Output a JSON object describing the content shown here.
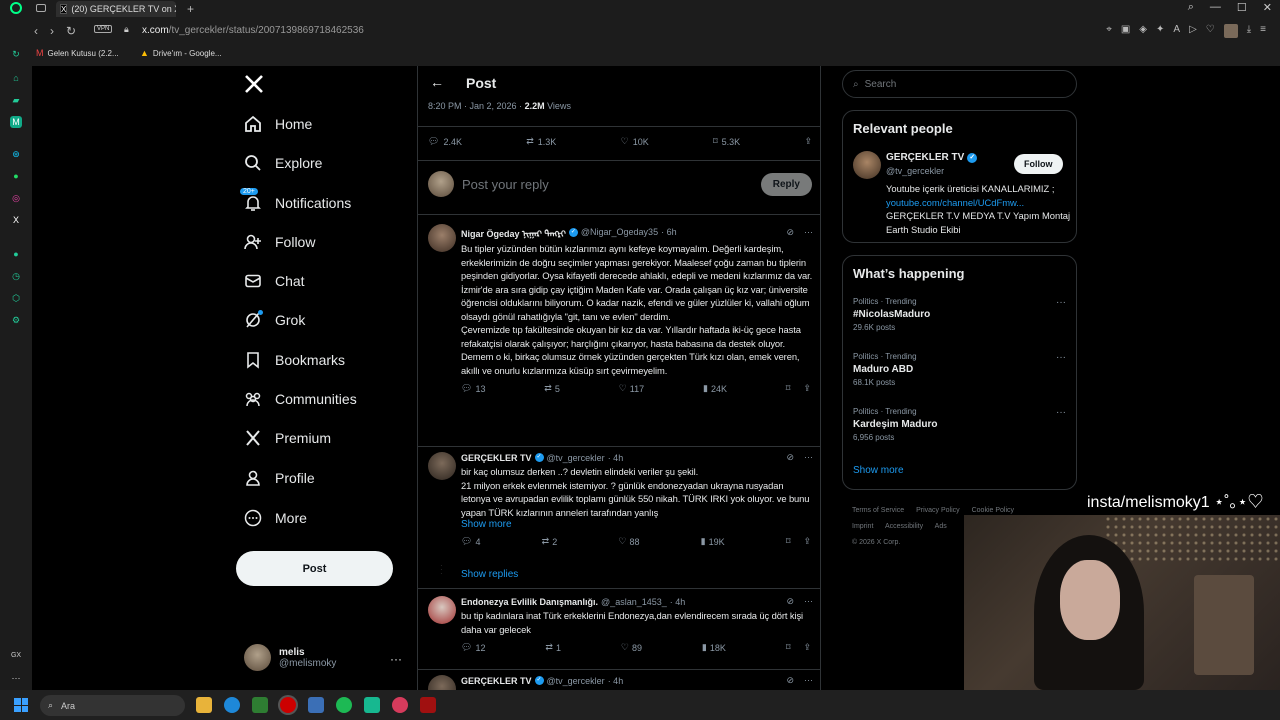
{
  "browser": {
    "tab_title": "(20) GERÇEKLER TV on X",
    "url_host": "x.com",
    "url_path": "/tv_gercekler/status/2007139869718462536",
    "vpn_label": "VPN",
    "bookmarks": [
      "Gelen Kutusu (2.2...",
      "Drive'ım - Google..."
    ]
  },
  "nav": {
    "logo": "X",
    "items": [
      {
        "label": "Home",
        "icon": "home-icon"
      },
      {
        "label": "Explore",
        "icon": "search-icon"
      },
      {
        "label": "Notifications",
        "icon": "bell-icon",
        "badge": "20+"
      },
      {
        "label": "Follow",
        "icon": "person-plus-icon"
      },
      {
        "label": "Chat",
        "icon": "mail-icon"
      },
      {
        "label": "Grok",
        "icon": "grok-icon"
      },
      {
        "label": "Bookmarks",
        "icon": "bookmark-icon"
      },
      {
        "label": "Communities",
        "icon": "people-icon"
      },
      {
        "label": "Premium",
        "icon": "x-icon"
      },
      {
        "label": "Profile",
        "icon": "person-icon"
      },
      {
        "label": "More",
        "icon": "more-circle-icon"
      }
    ],
    "post_button": "Post",
    "user_name": "melis",
    "user_handle": "@melismoky"
  },
  "post": {
    "header_title": "Post",
    "time": "8:20 PM · Jan 2, 2026 · ",
    "views": "2.2M",
    "views_label": "Views",
    "stats": {
      "replies": "2.4K",
      "reposts": "1.3K",
      "likes": "10K",
      "bookmarks": "5.3K"
    },
    "reply_placeholder": "Post your reply",
    "reply_button": "Reply"
  },
  "replies": [
    {
      "name": "Nigar Ögeday ᠨᠢᠭᠠᠷ ᠲᠠᠩᠷᠢ",
      "handle": "@Nigar_Ogeday35",
      "time": "· 6h",
      "text": "Bu tipler yüzünden bütün kızlarımızı aynı kefeye koymayalım. Değerli kardeşim, erkeklerimizin de doğru seçimler yapması gerekiyor. Maalesef çoğu zaman bu tiplerin peşinden gidiyorlar. Oysa kifayetli derecede ahlaklı, edepli ve medeni kızlarımız da var.\nİzmir'de ara sıra gidip çay içtiğim Maden Kafe var. Orada çalışan üç kız var; üniversite öğrencisi olduklarını biliyorum. O kadar nazik, efendi ve güler yüzlüler ki, vallahi oğlum olsaydı gönül rahatlığıyla \"git, tanı ve evlen\" derdim.\nÇevremizde tıp fakültesinde okuyan bir kız da var. Yıllardır haftada iki-üç gece hasta refakatçisi olarak çalışıyor; harçlığını çıkarıyor, hasta babasına da destek oluyor.\nDemem o ki, birkaç olumsuz örnek yüzünden gerçekten Türk kızı olan, emek veren, akıllı ve onurlu kızlarımıza küsüp sırt çevirmeyelim.",
      "replies": "13",
      "reposts": "5",
      "likes": "117",
      "views": "24K"
    },
    {
      "name": "GERÇEKLER TV",
      "handle": "@tv_gercekler",
      "time": "· 4h",
      "text": "bir kaç olumsuz derken ..? devletin elindeki veriler şu şekil.\n21 milyon erkek evlenmek istemiyor. ? günlük endonezyadan ukrayna rusyadan letonya ve avrupadan evlilik toplamı günlük 550 nikah. TÜRK IRKI yok oluyor. ve bunu yapan TÜRK kızlarının anneleri tarafından yanlış",
      "show_more": "Show more",
      "replies": "4",
      "reposts": "2",
      "likes": "88",
      "views": "19K"
    },
    {
      "name": "Endonezya Evlilik Danışmanlığı.",
      "handle": "@_aslan_1453_",
      "time": "· 4h",
      "text": "bu tip kadınlara inat Türk erkeklerini Endonezya,dan evlendirecem sırada üç dört kişi daha var gelecek",
      "replies": "12",
      "reposts": "1",
      "likes": "89",
      "views": "18K"
    },
    {
      "name": "GERÇEKLER TV",
      "handle": "@tv_gercekler",
      "time": "· 4h"
    }
  ],
  "show_replies": "Show replies",
  "right": {
    "search_placeholder": "Search",
    "relevant_title": "Relevant people",
    "person": {
      "name": "GERÇEKLER TV",
      "handle": "@tv_gercekler",
      "follow": "Follow",
      "bio1": "Youtube içerik üreticisi KANALLARIMIZ ; ",
      "bio_link": "youtube.com/channel/UCdFmw...",
      "bio2": "GERÇEKLER T.V MEDYA T.V Yapım Montaj Earth Studio Ekibi"
    },
    "happening_title": "What’s happening",
    "trends": [
      {
        "category": "Politics · Trending",
        "name": "#NicolasMaduro",
        "count": "29.6K posts"
      },
      {
        "category": "Politics · Trending",
        "name": "Maduro ABD",
        "count": "68.1K posts"
      },
      {
        "category": "Politics · Trending",
        "name": "Kardeşim Maduro",
        "count": "6,956 posts"
      }
    ],
    "show_more": "Show more",
    "footer": [
      "Terms of Service",
      "Privacy Policy",
      "Cookie Policy",
      "Imprint",
      "Accessibility",
      "Ads",
      "© 2026 X Corp."
    ]
  },
  "overlay": {
    "stream_text": "insta/melismoky1 ⋆˚｡⋆♡"
  },
  "taskbar": {
    "search": "Ara"
  },
  "colors": {
    "accent": "#1d9bf0",
    "background": "#000000",
    "text": "#e7e9ea",
    "muted": "#8b98a5"
  }
}
